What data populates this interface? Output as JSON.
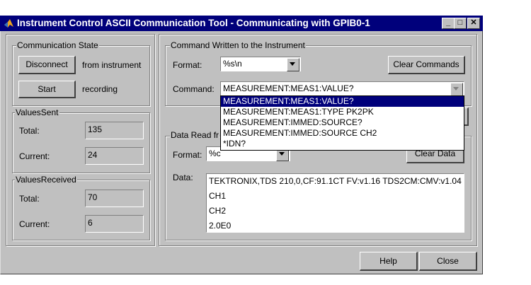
{
  "window": {
    "title": "Instrument Control ASCII Communication Tool - Communicating with GPIB0-1",
    "minimize_glyph": "_",
    "maximize_glyph": "□",
    "close_glyph": "✕"
  },
  "communication_state": {
    "title": "Communication State",
    "disconnect_label": "Disconnect",
    "disconnect_caption": "from instrument",
    "start_label": "Start",
    "start_caption": "recording"
  },
  "values_sent": {
    "title": "ValuesSent",
    "total_label": "Total:",
    "total_value": "135",
    "current_label": "Current:",
    "current_value": "24"
  },
  "values_received": {
    "title": "ValuesReceived",
    "total_label": "Total:",
    "total_value": "70",
    "current_label": "Current:",
    "current_value": "6"
  },
  "command_written": {
    "title": "Command Written to the Instrument",
    "format_label": "Format:",
    "format_value": "%s\\n",
    "clear_label": "Clear Commands",
    "command_label": "Command:",
    "command_value": "MEASUREMENT:MEAS1:VALUE?",
    "dropdown_items": [
      "MEASUREMENT:MEAS1:VALUE?",
      "MEASUREMENT:MEAS1:TYPE PK2PK",
      "MEASUREMENT:IMMED:SOURCE?",
      "MEASUREMENT:IMMED:SOURCE CH2",
      "*IDN?"
    ]
  },
  "data_read": {
    "title_partial": "Data Read fr",
    "format_label": "Format:",
    "format_value": "%c",
    "clear_label": "Clear Data",
    "data_label": "Data:",
    "data_lines": [
      "TEKTRONIX,TDS 210,0,CF:91.1CT FV:v1.16 TDS2CM:CMV:v1.04",
      "CH1",
      "CH2",
      "2.0E0"
    ]
  },
  "footer": {
    "help_label": "Help",
    "close_label": "Close"
  },
  "colors": {
    "titlebar": "#00007b",
    "face": "#c0c0c0",
    "selection": "#00007b"
  }
}
